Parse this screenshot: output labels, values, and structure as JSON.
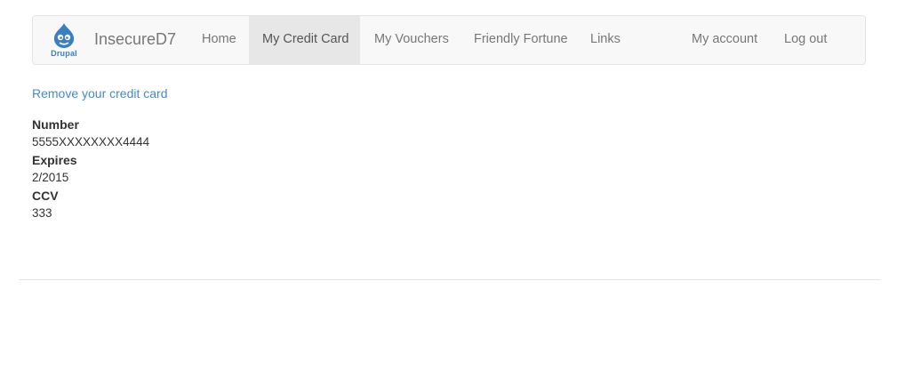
{
  "navbar": {
    "logo_text": "Drupal",
    "brand": "InsecureD7",
    "items": [
      {
        "label": "Home"
      },
      {
        "label": "My Credit Card"
      },
      {
        "label": "My Vouchers"
      },
      {
        "label": "Friendly Fortune"
      },
      {
        "label": "Links"
      }
    ],
    "right_items": [
      {
        "label": "My account"
      },
      {
        "label": "Log out"
      }
    ],
    "active_item": "My Credit Card"
  },
  "content": {
    "remove_link": "Remove your credit card",
    "fields": [
      {
        "label": "Number",
        "value": "5555XXXXXXXX4444"
      },
      {
        "label": "Expires",
        "value": "2/2015"
      },
      {
        "label": "CCV",
        "value": "333"
      }
    ]
  },
  "colors": {
    "link": "#428bca",
    "navbar_bg": "#f8f8f8",
    "active_bg": "#e7e7e7",
    "drupal_blue": "#3a7fc1"
  }
}
